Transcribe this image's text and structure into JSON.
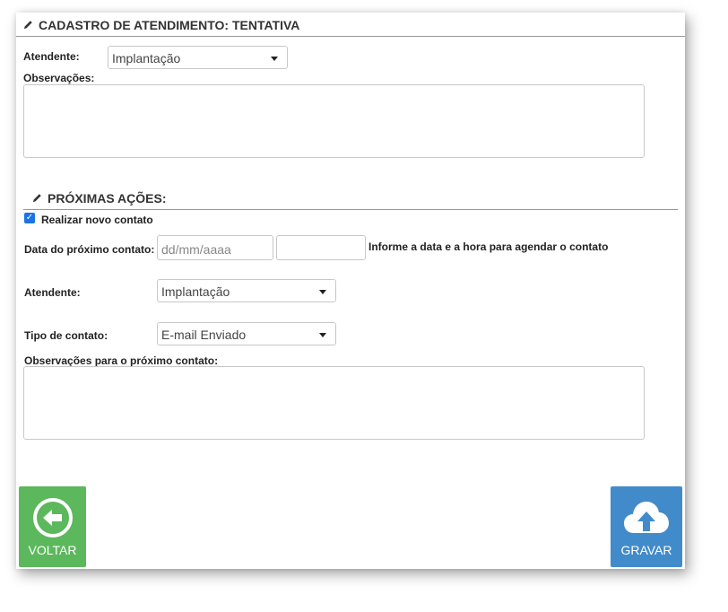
{
  "header": {
    "title": "CADASTRO DE ATENDIMENTO: TENTATIVA"
  },
  "attendance": {
    "attendant_label": "Atendente:",
    "attendant_value": "Implantação",
    "observations_label": "Observações:"
  },
  "next_actions": {
    "title": "PRÓXIMAS AÇÕES:",
    "new_contact_label": "Realizar novo contato",
    "new_contact_checked": true,
    "date_label": "Data do próximo contato:",
    "date_placeholder": "dd/mm/aaaa",
    "time_value": "",
    "date_hint": "Informe a data e a hora para agendar o contato",
    "attendant_label": "Atendente:",
    "attendant_value": "Implantação",
    "contact_type_label": "Tipo de contato:",
    "contact_type_value": "E-mail Enviado",
    "next_observations_label": "Observações para o próximo contato:"
  },
  "buttons": {
    "back_label": "VOLTAR",
    "back_color": "#5cb85c",
    "save_label": "GRAVAR",
    "save_color": "#428bca"
  },
  "icons": {
    "pencil": "pencil-icon",
    "back": "circle-arrow-left-icon",
    "save": "cloud-upload-icon"
  }
}
